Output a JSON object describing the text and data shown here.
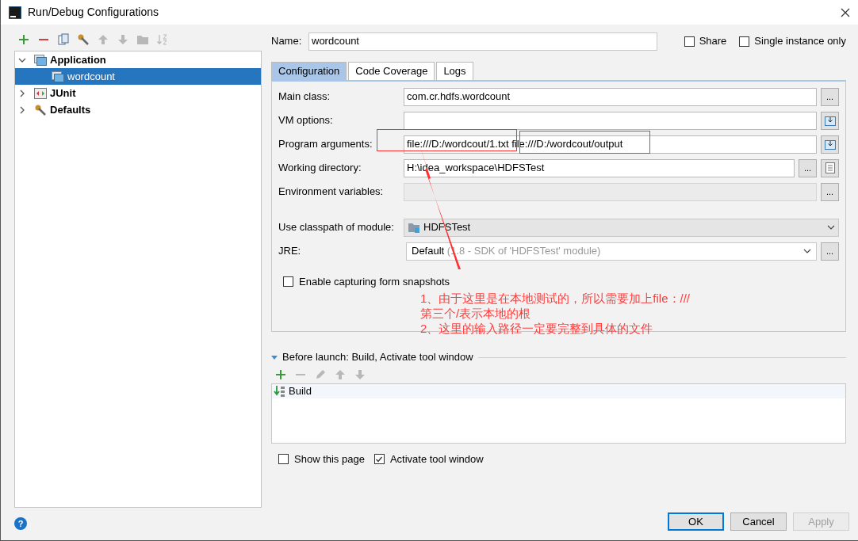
{
  "window": {
    "title": "Run/Debug Configurations"
  },
  "toolbar": [
    {
      "kind": "add",
      "disabled": false
    },
    {
      "kind": "remove",
      "disabled": false
    },
    {
      "kind": "copy",
      "disabled": false
    },
    {
      "kind": "wrench",
      "disabled": false
    },
    {
      "kind": "up",
      "disabled": true
    },
    {
      "kind": "down",
      "disabled": true
    },
    {
      "kind": "folder",
      "disabled": true
    },
    {
      "kind": "sort",
      "disabled": true
    }
  ],
  "tree": [
    {
      "label": "Application",
      "kind": "app",
      "expanded": true,
      "selected": false,
      "children": [
        {
          "label": "wordcount",
          "kind": "app",
          "selected": true
        }
      ]
    },
    {
      "label": "JUnit",
      "kind": "junit",
      "expanded": false,
      "selected": false
    },
    {
      "label": "Defaults",
      "kind": "wrench",
      "expanded": false,
      "selected": false
    }
  ],
  "name": {
    "label": "Name:",
    "value": "wordcount"
  },
  "options": [
    {
      "label": "Share",
      "checked": false
    },
    {
      "label": "Single instance only",
      "checked": false
    }
  ],
  "tabs": [
    {
      "label": "Configuration",
      "selected": true
    },
    {
      "label": "Code Coverage",
      "selected": false
    },
    {
      "label": "Logs",
      "selected": false
    }
  ],
  "fields": [
    {
      "kind": "text",
      "label": "Main class:",
      "value": "com.cr.hdfs.wordcount",
      "disabled": false,
      "actions": [
        {
          "kind": "browse",
          "label": "..."
        }
      ]
    },
    {
      "kind": "text",
      "label": "VM options:",
      "disabled": false,
      "actions": [
        {
          "kind": "expand"
        }
      ]
    },
    {
      "kind": "text",
      "label": "Program arguments:",
      "value": "file:///D:/wordcout/1.txt file:///D:/wordcout/output",
      "disabled": false,
      "actions": [
        {
          "kind": "expand"
        }
      ]
    },
    {
      "kind": "text",
      "label": "Working directory:",
      "value": "H:\\idea_workspace\\HDFSTest",
      "disabled": false,
      "actions": [
        {
          "kind": "browse",
          "label": "..."
        },
        {
          "kind": "file"
        }
      ]
    },
    {
      "kind": "text",
      "label": "Environment variables:",
      "disabled": true,
      "actions": [
        {
          "kind": "browse",
          "label": "..."
        }
      ]
    },
    {
      "kind": "module",
      "label": "Use classpath of module:",
      "value": "HDFSTest",
      "disabled": false
    },
    {
      "kind": "jre",
      "label": "JRE:",
      "value": "Default",
      "hint": "(1.8 - SDK of 'HDFSTest' module)",
      "disabled": false,
      "actions": [
        {
          "kind": "browse",
          "label": "..."
        }
      ]
    }
  ],
  "capture": {
    "label": "Enable capturing form snapshots",
    "checked": false
  },
  "before_launch": {
    "title": "Before launch: Build, Activate tool window",
    "expanded": true,
    "tools": [
      {
        "kind": "add",
        "disabled": false
      },
      {
        "kind": "remove",
        "disabled": true
      },
      {
        "kind": "edit",
        "disabled": true
      },
      {
        "kind": "up",
        "disabled": true
      },
      {
        "kind": "down",
        "disabled": true
      }
    ],
    "items": [
      {
        "label": "Build"
      }
    ]
  },
  "bottom_options": [
    {
      "label": "Show this page",
      "checked": false
    },
    {
      "label": "Activate tool window",
      "checked": true
    }
  ],
  "buttons": [
    {
      "label": "OK",
      "default": true,
      "disabled": false
    },
    {
      "label": "Cancel",
      "default": false,
      "disabled": false
    },
    {
      "label": "Apply",
      "default": false,
      "disabled": true
    }
  ],
  "help": {
    "label": "?"
  },
  "annotation": {
    "lines": [
      "1、由于这里是在本地测试的，所以需要加上file：///",
      "第三个/表示本地的根",
      "2、这里的输入路径一定要完整到具体的文件"
    ]
  }
}
